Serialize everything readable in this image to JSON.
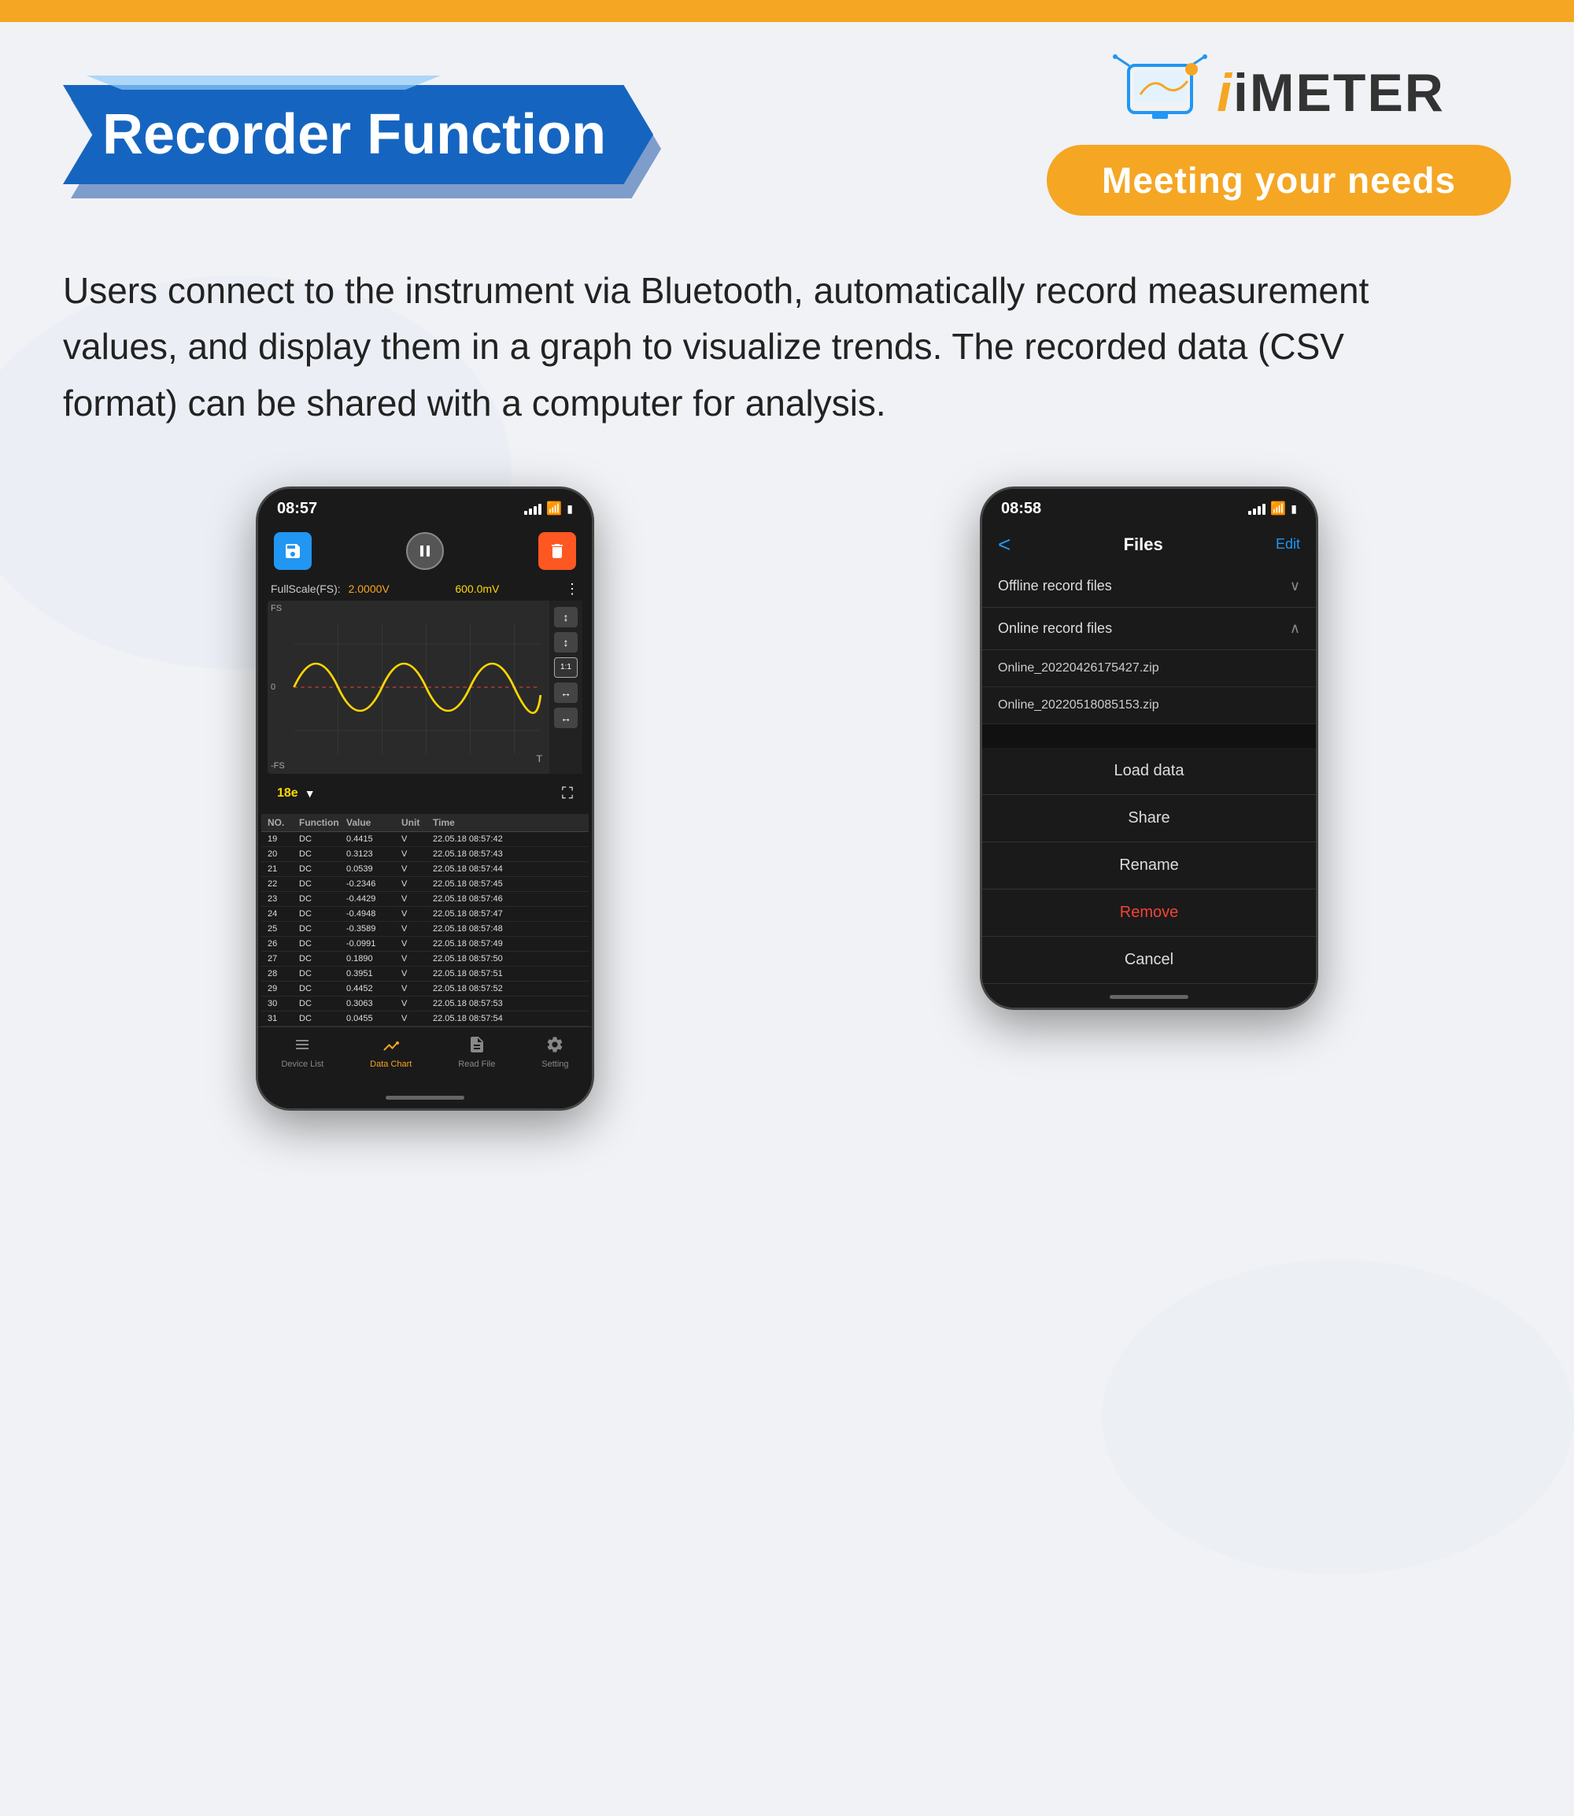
{
  "topBar": {
    "color": "#f5a623"
  },
  "header": {
    "recorderFunction": "Recorder Function",
    "imeterTagline": "Meeting your needs",
    "imeterText": "iMETER"
  },
  "description": "Users connect to the instrument via Bluetooth, automatically record measurement values, and display them in a graph to visualize trends. The recorded data (CSV format) can be shared with a computer for analysis.",
  "phone1": {
    "time": "08:57",
    "fullScale": "FullScale(FS):",
    "fsValue": "2.0000V",
    "fsValue2": "600.0mV",
    "fsLabel": "FS",
    "negFsLabel": "-FS",
    "tLabel": "T",
    "zeroLabel": "0",
    "selectorName": "18e",
    "table": {
      "headers": [
        "NO.",
        "Function",
        "Value",
        "Unit",
        "Time"
      ],
      "rows": [
        [
          "19",
          "DC",
          "0.4415",
          "V",
          "22.05.18 08:57:42"
        ],
        [
          "20",
          "DC",
          "0.3123",
          "V",
          "22.05.18 08:57:43"
        ],
        [
          "21",
          "DC",
          "0.0539",
          "V",
          "22.05.18 08:57:44"
        ],
        [
          "22",
          "DC",
          "-0.2346",
          "V",
          "22.05.18 08:57:45"
        ],
        [
          "23",
          "DC",
          "-0.4429",
          "V",
          "22.05.18 08:57:46"
        ],
        [
          "24",
          "DC",
          "-0.4948",
          "V",
          "22.05.18 08:57:47"
        ],
        [
          "25",
          "DC",
          "-0.3589",
          "V",
          "22.05.18 08:57:48"
        ],
        [
          "26",
          "DC",
          "-0.0991",
          "V",
          "22.05.18 08:57:49"
        ],
        [
          "27",
          "DC",
          "0.1890",
          "V",
          "22.05.18 08:57:50"
        ],
        [
          "28",
          "DC",
          "0.3951",
          "V",
          "22.05.18 08:57:51"
        ],
        [
          "29",
          "DC",
          "0.4452",
          "V",
          "22.05.18 08:57:52"
        ],
        [
          "30",
          "DC",
          "0.3063",
          "V",
          "22.05.18 08:57:53"
        ],
        [
          "31",
          "DC",
          "0.0455",
          "V",
          "22.05.18 08:57:54"
        ]
      ]
    },
    "nav": {
      "items": [
        {
          "name": "Device List",
          "active": false
        },
        {
          "name": "Data Chart",
          "active": true
        },
        {
          "name": "Read File",
          "active": false
        },
        {
          "name": "Setting",
          "active": false
        }
      ]
    }
  },
  "phone2": {
    "time": "08:58",
    "title": "Files",
    "editLabel": "Edit",
    "backSymbol": "<",
    "categories": [
      {
        "name": "Offline record files",
        "expanded": false,
        "arrow": "∨"
      },
      {
        "name": "Online record files",
        "expanded": true,
        "arrow": "∧"
      }
    ],
    "files": [
      {
        "name": "Online_20220426175427.zip"
      },
      {
        "name": "Online_20220518085153.zip"
      }
    ],
    "actions": [
      {
        "name": "Load data",
        "danger": false
      },
      {
        "name": "Share",
        "danger": false
      },
      {
        "name": "Rename",
        "danger": false
      },
      {
        "name": "Remove",
        "danger": true
      },
      {
        "name": "Cancel",
        "danger": false
      }
    ]
  }
}
